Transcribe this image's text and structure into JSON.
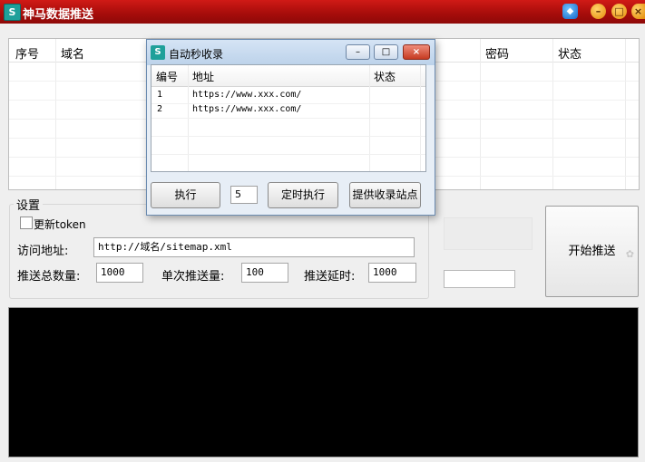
{
  "window": {
    "title": "神马数据推送",
    "logo_glyph": "S"
  },
  "title_buttons": [
    "skin-icon",
    "minimize-icon",
    "maximize-icon",
    "close-icon"
  ],
  "main_table": {
    "columns": [
      "序号",
      "域名",
      "密码",
      "状态"
    ]
  },
  "settings": {
    "group_title": "设置",
    "update_token_label": "更新token",
    "url_label": "访问地址:",
    "url_value": "http://域名/sitemap.xml",
    "total_label": "推送总数量:",
    "total_value": "1000",
    "single_label": "单次推送量:",
    "single_value": "100",
    "delay_label": "推送延时:",
    "delay_value": "1000"
  },
  "start_button": "开始推送",
  "dialog": {
    "title": "自动秒收录",
    "columns": [
      "编号",
      "地址",
      "状态"
    ],
    "rows": [
      {
        "id": "1",
        "url": "https://www.xxx.com/",
        "status": ""
      },
      {
        "id": "2",
        "url": "https://www.xxx.com/",
        "status": ""
      }
    ],
    "execute_label": "执行",
    "count_value": "5",
    "timed_execute_label": "定时执行",
    "provide_sites_label": "提供收录站点"
  },
  "colors": {
    "titlebar": "#b3100e",
    "console": "#000000",
    "dialog_frame": "#6b8bb0"
  }
}
